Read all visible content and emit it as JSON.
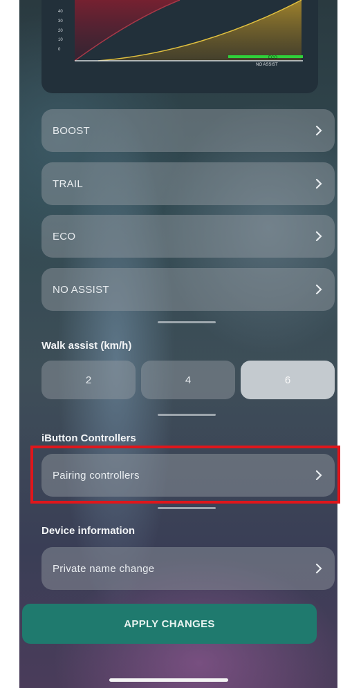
{
  "chart": {
    "y_ticks": [
      "40",
      "30",
      "20",
      "10",
      "0"
    ],
    "labels": [
      "ECO",
      "NO ASSIST"
    ],
    "colors": {
      "boost": "#8a2a3a",
      "trail": "#c9a227",
      "eco": "#2fd03a",
      "no_assist": "#d8dde0"
    }
  },
  "modes": [
    {
      "label": "BOOST"
    },
    {
      "label": "TRAIL"
    },
    {
      "label": "ECO"
    },
    {
      "label": "NO ASSIST"
    }
  ],
  "walk_assist": {
    "title": "Walk assist (km/h)",
    "options": [
      "2",
      "4",
      "6"
    ],
    "selected": "6"
  },
  "ibutton": {
    "title": "iButton Controllers",
    "item": "Pairing controllers"
  },
  "device": {
    "title": "Device information",
    "item": "Private name change"
  },
  "apply_label": "APPLY CHANGES",
  "accent_color": "#1f7a6e",
  "highlight_color": "#e0161b"
}
